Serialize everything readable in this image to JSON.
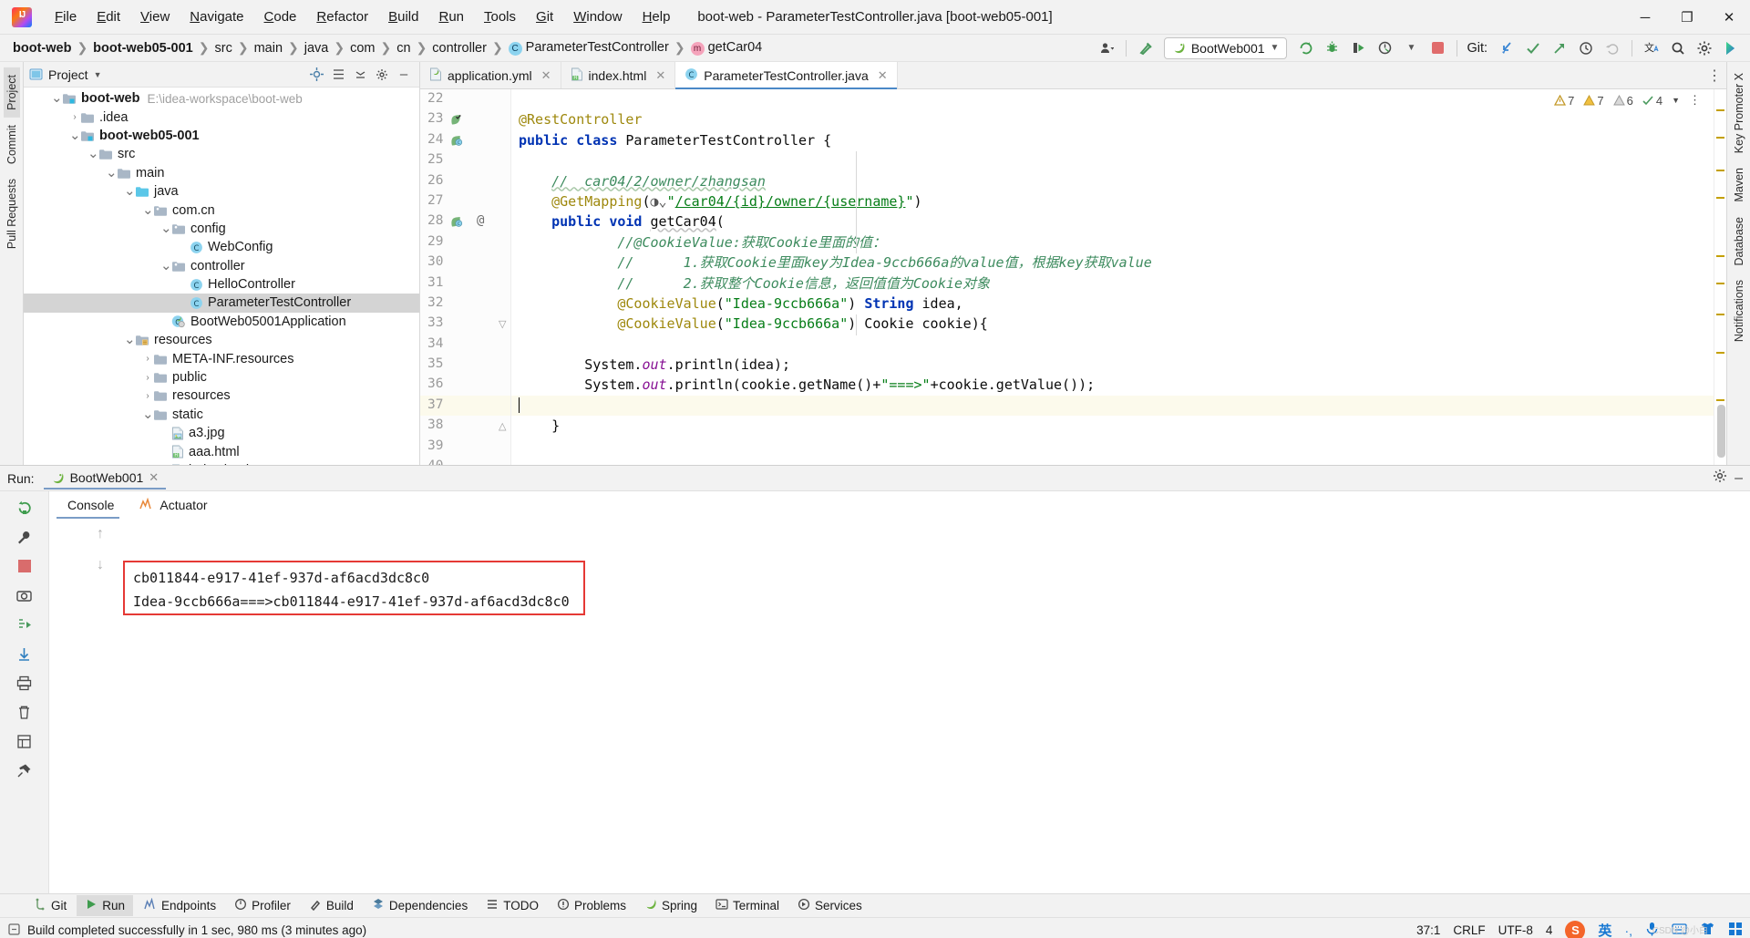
{
  "window": {
    "title": "boot-web - ParameterTestController.java [boot-web05-001]",
    "minimize": "─",
    "maximize": "❐",
    "close": "✕"
  },
  "menu": [
    {
      "label": "File",
      "mnemonic": "F"
    },
    {
      "label": "Edit",
      "mnemonic": "E"
    },
    {
      "label": "View",
      "mnemonic": "V"
    },
    {
      "label": "Navigate",
      "mnemonic": "N"
    },
    {
      "label": "Code",
      "mnemonic": "C"
    },
    {
      "label": "Refactor",
      "mnemonic": "R"
    },
    {
      "label": "Build",
      "mnemonic": "B"
    },
    {
      "label": "Run",
      "mnemonic": "R"
    },
    {
      "label": "Tools",
      "mnemonic": "T"
    },
    {
      "label": "Git",
      "mnemonic": "G"
    },
    {
      "label": "Window",
      "mnemonic": "W"
    },
    {
      "label": "Help",
      "mnemonic": "H"
    }
  ],
  "breadcrumb": [
    {
      "label": "boot-web",
      "bold": true,
      "badge": null
    },
    {
      "label": "boot-web05-001",
      "bold": true,
      "badge": null
    },
    {
      "label": "src",
      "bold": false,
      "badge": null
    },
    {
      "label": "main",
      "bold": false,
      "badge": null
    },
    {
      "label": "java",
      "bold": false,
      "badge": null
    },
    {
      "label": "com",
      "bold": false,
      "badge": null
    },
    {
      "label": "cn",
      "bold": false,
      "badge": null
    },
    {
      "label": "controller",
      "bold": false,
      "badge": null
    },
    {
      "label": "ParameterTestController",
      "bold": false,
      "badge": "C"
    },
    {
      "label": "getCar04",
      "bold": false,
      "badge": "m"
    }
  ],
  "toolbar": {
    "run_config": "BootWeb001",
    "git_label": "Git:",
    "icons": [
      "user-avatar-icon",
      "build-hammer-icon",
      "rerun-icon",
      "debug-icon",
      "run-with-coverage-icon",
      "profiler-icon",
      "stop-icon",
      "git-update-icon",
      "git-commit-icon",
      "git-push-icon",
      "git-history-icon",
      "git-rollback-icon",
      "translate-icon",
      "search-everywhere-icon",
      "settings-gear-icon",
      "ide-features-icon"
    ]
  },
  "left_strip_tabs": [
    "Project",
    "Commit",
    "Pull Requests"
  ],
  "right_strip_tabs": [
    "Key Promoter X",
    "Maven",
    "Database",
    "Notifications"
  ],
  "project": {
    "title": "Project",
    "tree": [
      {
        "indent": 0,
        "arrow": "v",
        "icon": "module-folder-icon",
        "label": "boot-web",
        "bold": true,
        "hint": "E:\\idea-workspace\\boot-web",
        "selected": false
      },
      {
        "indent": 1,
        "arrow": ">",
        "icon": "folder-icon",
        "label": ".idea",
        "bold": false,
        "hint": "",
        "selected": false
      },
      {
        "indent": 1,
        "arrow": "v",
        "icon": "module-folder-icon",
        "label": "boot-web05-001",
        "bold": true,
        "hint": "",
        "selected": false
      },
      {
        "indent": 2,
        "arrow": "v",
        "icon": "folder-icon",
        "label": "src",
        "bold": false,
        "hint": "",
        "selected": false
      },
      {
        "indent": 3,
        "arrow": "v",
        "icon": "folder-icon",
        "label": "main",
        "bold": false,
        "hint": "",
        "selected": false
      },
      {
        "indent": 4,
        "arrow": "v",
        "icon": "source-folder-icon",
        "label": "java",
        "bold": false,
        "hint": "",
        "selected": false
      },
      {
        "indent": 5,
        "arrow": "v",
        "icon": "package-icon",
        "label": "com.cn",
        "bold": false,
        "hint": "",
        "selected": false
      },
      {
        "indent": 6,
        "arrow": "v",
        "icon": "package-icon",
        "label": "config",
        "bold": false,
        "hint": "",
        "selected": false
      },
      {
        "indent": 7,
        "arrow": "",
        "icon": "java-class-icon",
        "label": "WebConfig",
        "bold": false,
        "hint": "",
        "selected": false
      },
      {
        "indent": 6,
        "arrow": "v",
        "icon": "package-icon",
        "label": "controller",
        "bold": false,
        "hint": "",
        "selected": false
      },
      {
        "indent": 7,
        "arrow": "",
        "icon": "java-class-icon",
        "label": "HelloController",
        "bold": false,
        "hint": "",
        "selected": false
      },
      {
        "indent": 7,
        "arrow": "",
        "icon": "java-class-icon",
        "label": "ParameterTestController",
        "bold": false,
        "hint": "",
        "selected": true
      },
      {
        "indent": 6,
        "arrow": "",
        "icon": "spring-boot-icon",
        "label": "BootWeb05001Application",
        "bold": false,
        "hint": "",
        "selected": false
      },
      {
        "indent": 4,
        "arrow": "v",
        "icon": "resources-folder-icon",
        "label": "resources",
        "bold": false,
        "hint": "",
        "selected": false
      },
      {
        "indent": 5,
        "arrow": ">",
        "icon": "folder-icon",
        "label": "META-INF.resources",
        "bold": false,
        "hint": "",
        "selected": false
      },
      {
        "indent": 5,
        "arrow": ">",
        "icon": "folder-icon",
        "label": "public",
        "bold": false,
        "hint": "",
        "selected": false
      },
      {
        "indent": 5,
        "arrow": ">",
        "icon": "folder-icon",
        "label": "resources",
        "bold": false,
        "hint": "",
        "selected": false
      },
      {
        "indent": 5,
        "arrow": "v",
        "icon": "folder-icon",
        "label": "static",
        "bold": false,
        "hint": "",
        "selected": false
      },
      {
        "indent": 6,
        "arrow": "",
        "icon": "image-file-icon",
        "label": "a3.jpg",
        "bold": false,
        "hint": "",
        "selected": false
      },
      {
        "indent": 6,
        "arrow": "",
        "icon": "html-file-icon",
        "label": "aaa.html",
        "bold": false,
        "hint": "",
        "selected": false
      },
      {
        "indent": 6,
        "arrow": "",
        "icon": "html-file-icon",
        "label": "index.html",
        "bold": false,
        "hint": "",
        "selected": false
      }
    ]
  },
  "editor": {
    "tabs": [
      {
        "label": "application.yml",
        "icon": "yaml-file-icon",
        "active": false
      },
      {
        "label": "index.html",
        "icon": "html-file-icon",
        "active": false
      },
      {
        "label": "ParameterTestController.java",
        "icon": "java-class-icon",
        "active": true
      }
    ],
    "inspection": {
      "warnings1": "7",
      "warnings2": "7",
      "weak": "6",
      "ok": "4"
    },
    "lines": [
      {
        "num": "22",
        "gutter": "",
        "at": "",
        "text": ""
      },
      {
        "num": "23",
        "gutter": "bookmark-check-icon",
        "at": "",
        "text": "@RestController"
      },
      {
        "num": "24",
        "gutter": "spring-bean-icon",
        "at": "",
        "text": "public class ParameterTestController {"
      },
      {
        "num": "25",
        "gutter": "",
        "at": "",
        "text": ""
      },
      {
        "num": "26",
        "gutter": "",
        "at": "",
        "text": "    //  car04/2/owner/zhangsan"
      },
      {
        "num": "27",
        "gutter": "",
        "at": "",
        "text": "    @GetMapping(\"/car04/{id}/owner/{username}\")"
      },
      {
        "num": "28",
        "gutter": "spring-bean-icon",
        "at": "@",
        "text": "    public void getCar04("
      },
      {
        "num": "29",
        "gutter": "",
        "at": "",
        "text": "            //@CookieValue:获取Cookie里面的值："
      },
      {
        "num": "30",
        "gutter": "",
        "at": "",
        "text": "            //      1.获取Cookie里面key为Idea-9ccb666a的value值，根据key获取value"
      },
      {
        "num": "31",
        "gutter": "",
        "at": "",
        "text": "            //      2.获取整个Cookie信息，返回值值为Cookie对象"
      },
      {
        "num": "32",
        "gutter": "",
        "at": "",
        "text": "            @CookieValue(\"Idea-9ccb666a\") String idea,"
      },
      {
        "num": "33",
        "gutter": "",
        "at": "",
        "text": "            @CookieValue(\"Idea-9ccb666a\") Cookie cookie){"
      },
      {
        "num": "34",
        "gutter": "",
        "at": "",
        "text": ""
      },
      {
        "num": "35",
        "gutter": "",
        "at": "",
        "text": "        System.out.println(idea);"
      },
      {
        "num": "36",
        "gutter": "",
        "at": "",
        "text": "        System.out.println(cookie.getName()+\"===>\"+cookie.getValue());"
      },
      {
        "num": "37",
        "gutter": "",
        "at": "",
        "text": ""
      },
      {
        "num": "38",
        "gutter": "",
        "at": "",
        "text": "    }"
      },
      {
        "num": "39",
        "gutter": "",
        "at": "",
        "text": ""
      },
      {
        "num": "40",
        "gutter": "",
        "at": "",
        "text": ""
      }
    ]
  },
  "run_panel": {
    "label": "Run:",
    "tab": "BootWeb001",
    "console_tabs": [
      {
        "label": "Console",
        "icon": "console-icon",
        "active": true
      },
      {
        "label": "Actuator",
        "icon": "actuator-icon",
        "active": false
      }
    ],
    "output": [
      "cb011844-e917-41ef-937d-af6acd3dc8c0",
      "Idea-9ccb666a===>cb011844-e917-41ef-937d-af6acd3dc8c0"
    ],
    "highlight_color": "#e53935"
  },
  "bottom_tools": [
    {
      "label": "Git",
      "icon": "git-branch-icon",
      "active": false
    },
    {
      "label": "Run",
      "icon": "run-icon",
      "active": true
    },
    {
      "label": "Endpoints",
      "icon": "endpoints-icon",
      "active": false
    },
    {
      "label": "Profiler",
      "icon": "profiler-icon",
      "active": false
    },
    {
      "label": "Build",
      "icon": "build-hammer-icon",
      "active": false
    },
    {
      "label": "Dependencies",
      "icon": "dependencies-icon",
      "active": false
    },
    {
      "label": "TODO",
      "icon": "todo-icon",
      "active": false
    },
    {
      "label": "Problems",
      "icon": "problems-icon",
      "active": false
    },
    {
      "label": "Spring",
      "icon": "spring-icon",
      "active": false
    },
    {
      "label": "Terminal",
      "icon": "terminal-icon",
      "active": false
    },
    {
      "label": "Services",
      "icon": "services-icon",
      "active": false
    }
  ],
  "status": {
    "message": "Build completed successfully in 1 sec, 980 ms (3 minutes ago)",
    "caret": "37:1",
    "line_sep": "CRLF",
    "encoding": "UTF-8",
    "indent": "4",
    "ime_logo": "S",
    "ime_lang": "英",
    "watermark": "CSDN @小白"
  }
}
